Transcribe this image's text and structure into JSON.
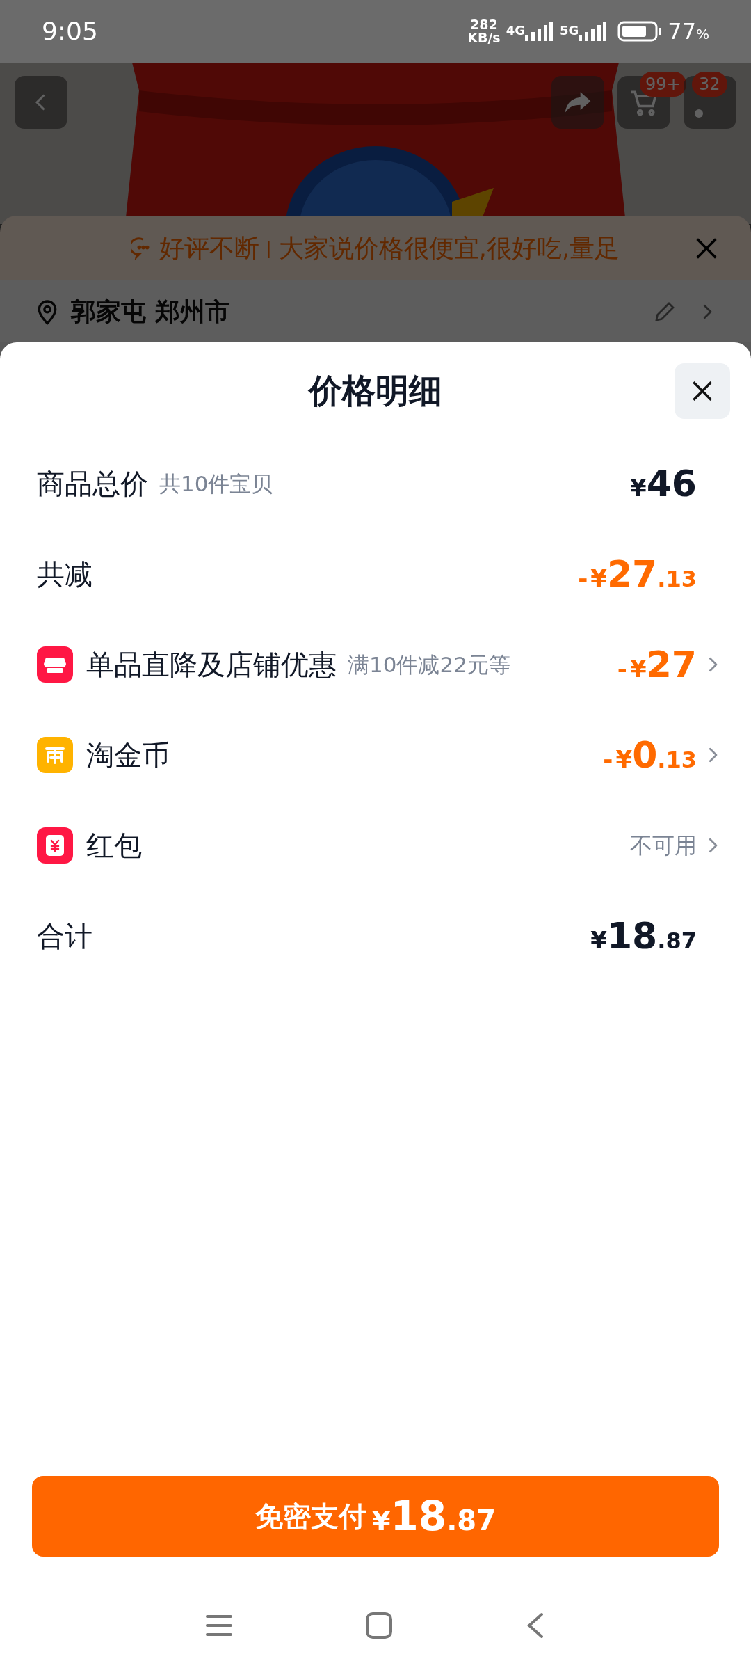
{
  "status_bar": {
    "time": "9:05",
    "speed_value": "282",
    "speed_unit": "KB/s",
    "network_1": "4G",
    "network_2": "5G",
    "battery": "77",
    "battery_unit": "%"
  },
  "header": {
    "cart_badge": "99+",
    "message_badge": "32"
  },
  "review_banner": {
    "tag": "好评不断",
    "divider": "|",
    "text": "大家说价格很便宜,很好吃,量足"
  },
  "address": {
    "text": "郭家屯 郑州市"
  },
  "sheet": {
    "title": "价格明细",
    "rows": [
      {
        "kind": "subtotal",
        "label": "商品总价",
        "note": "共10件宝贝",
        "price": {
          "currency": "¥",
          "integer": "46"
        }
      },
      {
        "kind": "discount",
        "label": "共减",
        "price": {
          "sign": "-",
          "currency": "¥",
          "integer": "27",
          "decimal": ".13"
        }
      },
      {
        "kind": "store",
        "label": "单品直降及店铺优惠",
        "note": "满10件减22元等",
        "price": {
          "sign": "-",
          "currency": "¥",
          "integer": "27"
        }
      },
      {
        "kind": "coin",
        "label": "淘金币",
        "price": {
          "sign": "-",
          "currency": "¥",
          "integer": "0",
          "decimal": ".13"
        }
      },
      {
        "kind": "packet",
        "label": "红包",
        "status": "不可用"
      },
      {
        "kind": "total",
        "label": "合计",
        "price": {
          "currency": "¥",
          "integer": "18",
          "decimal": ".87"
        }
      }
    ],
    "pay_button": {
      "label": "免密支付",
      "price": {
        "currency": "¥",
        "integer": "18",
        "decimal": ".87"
      }
    }
  }
}
